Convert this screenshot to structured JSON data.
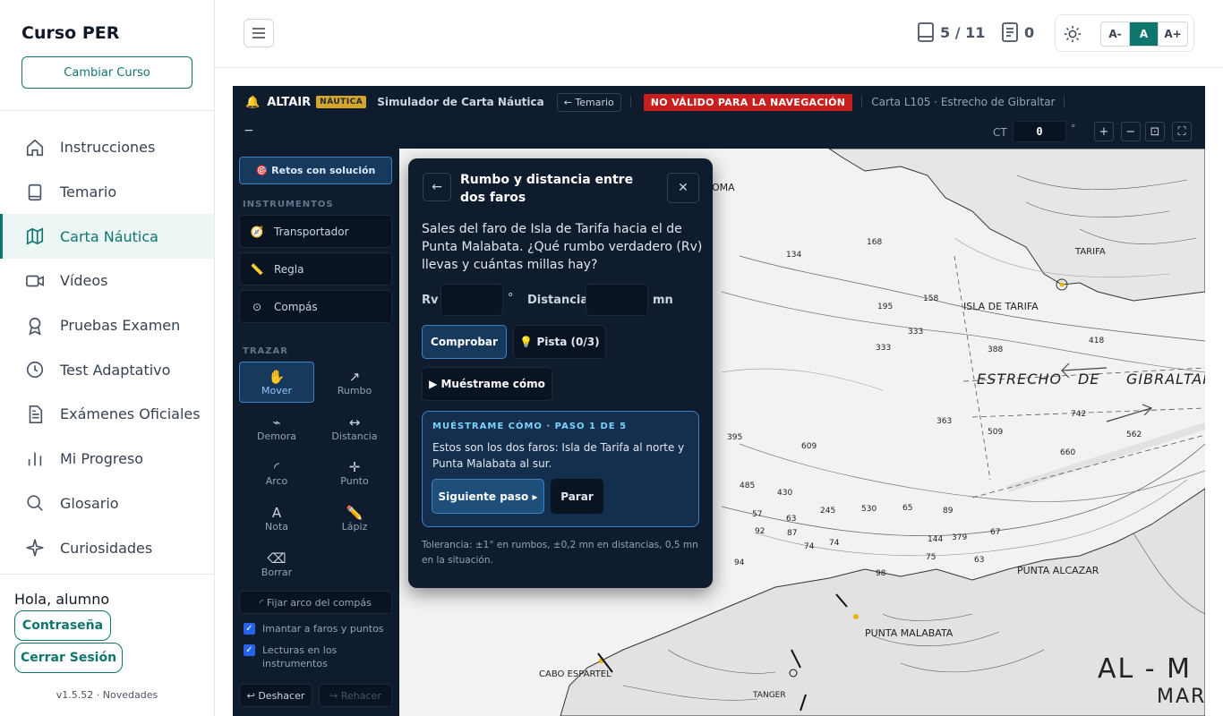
{
  "sidebar": {
    "brand": "Curso PER",
    "change_course": "Cambiar Curso",
    "items": [
      {
        "label": "Instrucciones",
        "icon": "home-icon"
      },
      {
        "label": "Temario",
        "icon": "book-icon"
      },
      {
        "label": "Carta Náutica",
        "icon": "map-icon",
        "active": true
      },
      {
        "label": "Vídeos",
        "icon": "video-icon"
      },
      {
        "label": "Pruebas Examen",
        "icon": "award-icon"
      },
      {
        "label": "Test Adaptativo",
        "icon": "clock-icon"
      },
      {
        "label": "Exámenes Oficiales",
        "icon": "document-icon"
      },
      {
        "label": "Mi Progreso",
        "icon": "bar-chart-icon"
      },
      {
        "label": "Glosario",
        "icon": "search-icon"
      },
      {
        "label": "Curiosidades",
        "icon": "sparkle-icon"
      }
    ],
    "greeting": "Hola, alumno",
    "password_btn": "Contraseña",
    "logout_btn": "Cerrar Sesión",
    "version": "v1.5.52 · Novedades"
  },
  "topbar": {
    "progress": "5 / 11",
    "notes_count": "0",
    "font_small": "A-",
    "font_normal": "A",
    "font_large": "A+"
  },
  "app": {
    "name": "ALTAIR",
    "badge": "NÁUTICA",
    "subtitle": "Simulador de Carta Náutica",
    "temario_btn": "← Temario",
    "warning": "NO VÁLIDO PARA LA NAVEGACIÓN",
    "chart_title": "Carta L105 · Estrecho de Gibraltar",
    "collapse": "−",
    "ct_label": "CT",
    "ct_value": "0",
    "deg": "°",
    "zoom_in": "+",
    "zoom_out": "−",
    "fit": "⊡",
    "fullscreen": "⛶"
  },
  "tools": {
    "retos": "🎯 Retos con solución",
    "instruments_title": "INSTRUMENTOS",
    "instruments": [
      {
        "label": "Transportador",
        "icon": "🧭"
      },
      {
        "label": "Regla",
        "icon": "📏"
      },
      {
        "label": "Compás",
        "icon": "⊙"
      }
    ],
    "draw_title": "TRAZAR",
    "draw_tools": [
      {
        "label": "Mover",
        "glyph": "✋"
      },
      {
        "label": "Rumbo",
        "glyph": "↗"
      },
      {
        "label": "Demora",
        "glyph": "⌁"
      },
      {
        "label": "Distancia",
        "glyph": "↔"
      },
      {
        "label": "Arco",
        "glyph": "◜"
      },
      {
        "label": "Punto",
        "glyph": "✛"
      },
      {
        "label": "Nota",
        "glyph": "A"
      },
      {
        "label": "Lápiz",
        "glyph": "✏️"
      },
      {
        "label": "Borrar",
        "glyph": "⌫"
      }
    ],
    "fix_arc": "◜ Fijar arco del compás",
    "magnet": "Imantar a faros y puntos",
    "readings": "Lecturas en los instrumentos",
    "undo": "↩ Deshacer",
    "redo": "↪ Rehacer"
  },
  "map_labels": {
    "punta_paloma": "PUNTA PALOMA",
    "isla_tarifa": "ISLA DE TARIFA",
    "tarifa": "TARIFA",
    "estrecho": "ESTRECHO",
    "de": "DE",
    "gibraltar": "GIBRALTAR",
    "punta_alcazar": "PUNTA ALCAZAR",
    "punta_malabata": "PUNTA MALABATA",
    "cabo_espartel": "CABO ESPARTEL",
    "tanger": "TANGER",
    "al_m": "AL - M",
    "mar": "MAR",
    "depths": [
      "134",
      "168",
      "158",
      "195",
      "333",
      "388",
      "418",
      "742",
      "363",
      "509",
      "609",
      "562",
      "660",
      "395",
      "245",
      "430",
      "485",
      "530",
      "379",
      "333",
      "65",
      "144",
      "57",
      "63",
      "74",
      "74",
      "98",
      "94",
      "92",
      "87",
      "67",
      "75",
      "89",
      "63"
    ]
  },
  "modal": {
    "back": "←",
    "title": "Rumbo y distancia entre dos faros",
    "close": "✕",
    "question": "Sales del faro de Isla de Tarifa hacia el de Punta Malabata. ¿Qué rumbo verdadero (Rv) llevas y cuántas millas hay?",
    "rv_label": "Rv",
    "deg": "°",
    "dist_label": "Distancia",
    "unit": "mn",
    "check": "Comprobar",
    "hint": "💡 Pista (0/3)",
    "show": "▶ Muéstrame cómo",
    "step_header": "MUÉSTRAME CÓMO · PASO 1 DE 5",
    "step_text": "Estos son los dos faros: Isla de Tarifa al norte y Punta Malabata al sur.",
    "next": "Siguiente paso ▸",
    "stop": "Parar",
    "tolerance": "Tolerancia: ±1° en rumbos, ±0,2 mn en distancias, 0,5 mn en la situación."
  }
}
